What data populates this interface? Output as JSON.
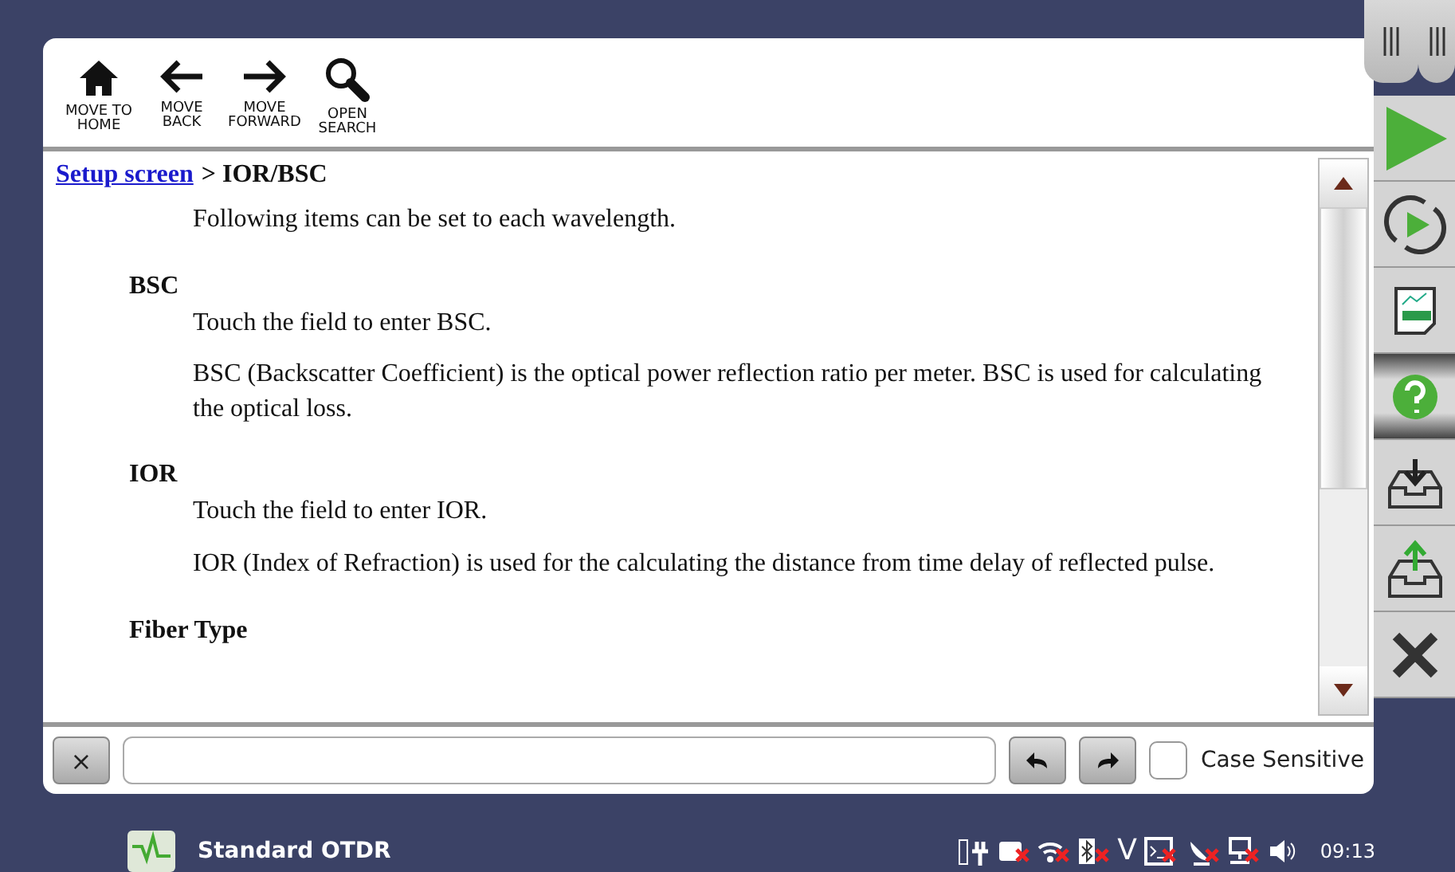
{
  "toolbar": [
    {
      "kind": "home",
      "label": "MOVE TO\nHOME"
    },
    {
      "kind": "back",
      "label": "MOVE\nBACK"
    },
    {
      "kind": "forward",
      "label": "MOVE\nFORWARD"
    },
    {
      "kind": "search",
      "label": "OPEN\nSEARCH"
    }
  ],
  "breadcrumb": {
    "link": "Setup screen",
    "current": "> IOR/BSC"
  },
  "intro": "Following items can be set to each wavelength.",
  "sections": [
    {
      "heading": "BSC",
      "paragraphs": [
        "Touch the field to enter BSC.",
        "BSC (Backscatter Coefficient) is the optical power reflection ratio per meter. BSC is used for calculating the optical loss."
      ]
    },
    {
      "heading": "IOR",
      "paragraphs": [
        "Touch the field to enter IOR.",
        "IOR (Index of Refraction) is used for the calculating the distance from time delay of reflected pulse."
      ]
    },
    {
      "heading": "Fiber Type"
    }
  ],
  "search_bar": {
    "clear": "×",
    "case_sensitive": {
      "label": "Case Sensitive",
      "checked": false
    }
  },
  "side_buttons": [
    {
      "kind": "start",
      "selected": false
    },
    {
      "kind": "repeat",
      "selected": false
    },
    {
      "kind": "report",
      "selected": false
    },
    {
      "kind": "help",
      "selected": true
    },
    {
      "kind": "import",
      "selected": false
    },
    {
      "kind": "export",
      "selected": false
    },
    {
      "kind": "close",
      "selected": false
    }
  ],
  "taskbar": {
    "app": "Standard OTDR",
    "status": [
      {
        "kind": "power",
        "off": false
      },
      {
        "kind": "camera",
        "off": true
      },
      {
        "kind": "wifi",
        "off": true
      },
      {
        "kind": "bluetooth",
        "off": true
      },
      {
        "kind": "letter",
        "text": "V"
      },
      {
        "kind": "terminal",
        "off": true
      },
      {
        "kind": "satellite",
        "off": true
      },
      {
        "kind": "network",
        "off": true
      },
      {
        "kind": "volume",
        "off": false
      }
    ],
    "time": "09:13"
  }
}
